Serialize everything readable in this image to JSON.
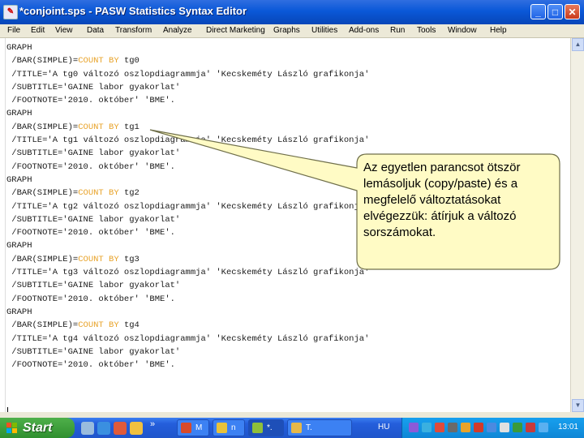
{
  "window": {
    "title": "*conjoint.sps - PASW Statistics Syntax Editor",
    "minimize_label": "_",
    "maximize_label": "□",
    "close_label": "✕"
  },
  "menu": [
    "File",
    "Edit",
    "View",
    "Data",
    "Transform",
    "Analyze",
    "Direct Marketing",
    "Graphs",
    "Utilities",
    "Add-ons",
    "Run",
    "Tools",
    "Window",
    "Help"
  ],
  "code_lines": [
    {
      "plain": "GRAPH"
    },
    {
      "pre": " /BAR(SIMPLE)=",
      "kw": "COUNT BY",
      "post": " tg0"
    },
    {
      "plain": " /TITLE='A tg0 változó oszlopdiagrammja' 'Kecskeméty László grafikonja'"
    },
    {
      "plain": " /SUBTITLE='GAINE labor gyakorlat'"
    },
    {
      "plain": " /FOOTNOTE='2010. október' 'BME'."
    },
    {
      "plain": "GRAPH"
    },
    {
      "pre": " /BAR(SIMPLE)=",
      "kw": "COUNT BY",
      "post": " tg1"
    },
    {
      "plain": " /TITLE='A tg1 változó oszlopdiagrammja' 'Kecskeméty László grafikonja'"
    },
    {
      "plain": " /SUBTITLE='GAINE labor gyakorlat'"
    },
    {
      "plain": " /FOOTNOTE='2010. október' 'BME'."
    },
    {
      "plain": "GRAPH"
    },
    {
      "pre": " /BAR(SIMPLE)=",
      "kw": "COUNT BY",
      "post": " tg2"
    },
    {
      "plain": " /TITLE='A tg2 változó oszlopdiagrammja' 'Kecskeméty László grafikonja'"
    },
    {
      "plain": " /SUBTITLE='GAINE labor gyakorlat'"
    },
    {
      "plain": " /FOOTNOTE='2010. október' 'BME'."
    },
    {
      "plain": "GRAPH"
    },
    {
      "pre": " /BAR(SIMPLE)=",
      "kw": "COUNT BY",
      "post": " tg3"
    },
    {
      "plain": " /TITLE='A tg3 változó oszlopdiagrammja' 'Kecskeméty László grafikonja'"
    },
    {
      "plain": " /SUBTITLE='GAINE labor gyakorlat'"
    },
    {
      "plain": " /FOOTNOTE='2010. október' 'BME'."
    },
    {
      "plain": "GRAPH"
    },
    {
      "pre": " /BAR(SIMPLE)=",
      "kw": "COUNT BY",
      "post": " tg4"
    },
    {
      "plain": " /TITLE='A tg4 változó oszlopdiagrammja' 'Kecskeméty László grafikonja'"
    },
    {
      "plain": " /SUBTITLE='GAINE labor gyakorlat'"
    },
    {
      "plain": " /FOOTNOTE='2010. október' 'BME'."
    }
  ],
  "callout": {
    "text": "Az egyetlen parancsot ötször lemásoljuk (copy/paste) és a megfelelő változtatásokat elvégezzük: átírjuk a változó sorszámokat."
  },
  "taskbar": {
    "start_label": "Start",
    "buttons": [
      {
        "label": "M",
        "color": "#d84a2a"
      },
      {
        "label": "n",
        "color": "#e8c23a"
      },
      {
        "label": "*.",
        "color": "#8fbf3a"
      },
      {
        "label": "T.",
        "color": "#e6b84a"
      }
    ],
    "language": "HU",
    "clock": "13:01"
  },
  "colors": {
    "keyword": "#e8a32a",
    "callout_fill": "#fffbc5",
    "callout_border": "#6f6f4a",
    "titlebar": "#0a58d8"
  }
}
